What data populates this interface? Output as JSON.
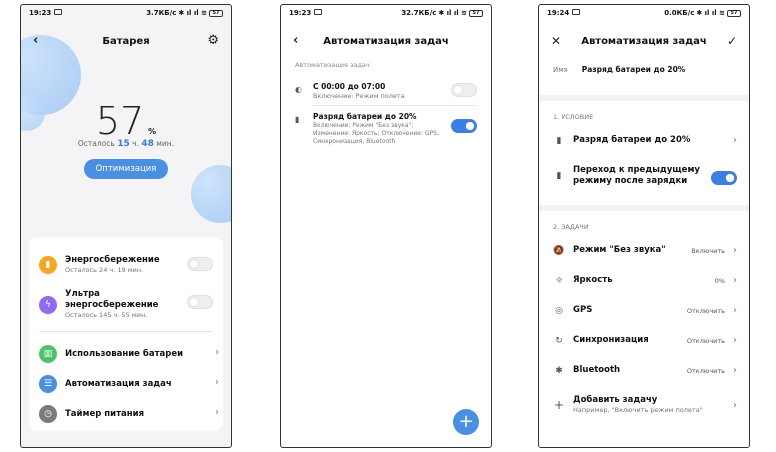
{
  "screen1": {
    "status": {
      "time": "19:23",
      "speed": "3.7КБ/с",
      "battery": "57"
    },
    "header": {
      "title": "Батарея"
    },
    "percent": "57",
    "percent_sign": "%",
    "remaining": {
      "prefix": "Осталось",
      "hours": "15",
      "hours_unit": "ч.",
      "minutes": "48",
      "minutes_unit": "мин."
    },
    "optimize_label": "Оптимизация",
    "items": [
      {
        "title": "Энергосбережение",
        "subtitle": "Осталось 24 ч. 19 мин.",
        "color": "#f5a623"
      },
      {
        "title": "Ультра энергосбережение",
        "subtitle": "Осталось 145 ч. 55 мин.",
        "color": "#8e6df0"
      },
      {
        "title": "Использование батареи",
        "color": "#4cc36d"
      },
      {
        "title": "Автоматизация задач",
        "color": "#4a90e2"
      },
      {
        "title": "Таймер питания",
        "color": "#7a7a7a"
      }
    ]
  },
  "screen2": {
    "status": {
      "time": "19:23",
      "speed": "32.7КБ/с",
      "battery": "57"
    },
    "header": {
      "title": "Автоматизация задач"
    },
    "section": "Автоматизация задач",
    "tasks": [
      {
        "title": "С 00:00 до 07:00",
        "subtitle": "Включение: Режим полета",
        "enabled": false
      },
      {
        "title": "Разряд батареи до 20%",
        "subtitle": "Включение: Режим \"Без звука\"; Изменение: Яркость; Отключение: GPS, Синхронизация, Bluetooth",
        "enabled": true
      }
    ],
    "fab": "+"
  },
  "screen3": {
    "status": {
      "time": "19:24",
      "speed": "0.0КБ/с",
      "battery": "57"
    },
    "header": {
      "title": "Автоматизация задач"
    },
    "name_label": "Имя",
    "name_value": "Разряд батареи до 20%",
    "section1": "1. УСЛОВИЕ",
    "conditions": [
      {
        "label": "Разряд батареи до 20%"
      },
      {
        "label": "Переход к предыдущему режиму после зарядки",
        "enabled": true
      }
    ],
    "section2": "2. ЗАДАЧИ",
    "actions": [
      {
        "label": "Режим \"Без звука\"",
        "value": "Включить",
        "icon": "mute-icon"
      },
      {
        "label": "Яркость",
        "value": "0%",
        "icon": "brightness-icon"
      },
      {
        "label": "GPS",
        "value": "Отключить",
        "icon": "gps-icon"
      },
      {
        "label": "Синхронизация",
        "value": "Отключить",
        "icon": "sync-icon"
      },
      {
        "label": "Bluetooth",
        "value": "Отключить",
        "icon": "bluetooth-icon"
      }
    ],
    "add_task": {
      "label": "Добавить задачу",
      "hint": "Например, \"Включить режим полета\""
    }
  }
}
